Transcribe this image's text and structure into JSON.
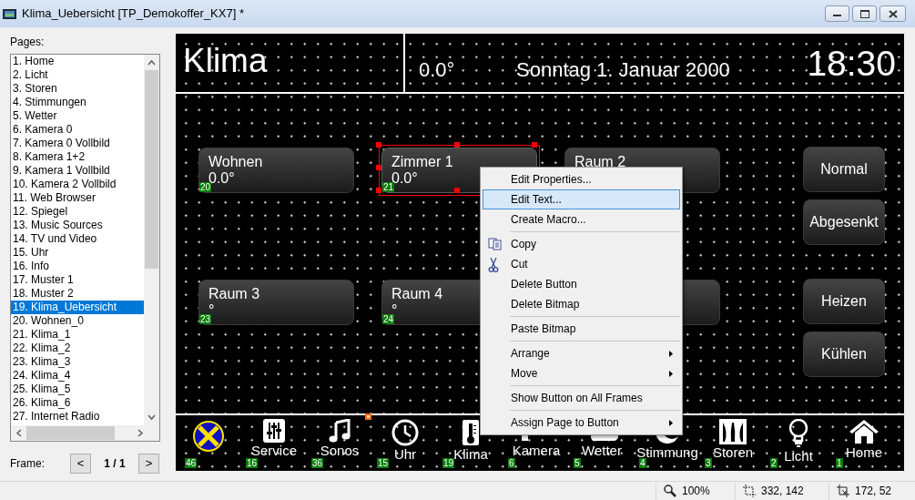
{
  "window": {
    "title": "Klima_Uebersicht [TP_Demokoffer_KX7] *"
  },
  "pages": {
    "label": "Pages:",
    "items": [
      {
        "label": "1. Home",
        "selected": false
      },
      {
        "label": "2. Licht",
        "selected": false
      },
      {
        "label": "3. Storen",
        "selected": false
      },
      {
        "label": "4. Stimmungen",
        "selected": false
      },
      {
        "label": "5. Wetter",
        "selected": false
      },
      {
        "label": "6. Kamera 0",
        "selected": false
      },
      {
        "label": "7. Kamera 0 Vollbild",
        "selected": false
      },
      {
        "label": "8. Kamera 1+2",
        "selected": false
      },
      {
        "label": "9. Kamera 1 Vollbild",
        "selected": false
      },
      {
        "label": "10. Kamera 2 Vollbild",
        "selected": false
      },
      {
        "label": "11. Web Browser",
        "selected": false
      },
      {
        "label": "12. Spiegel",
        "selected": false
      },
      {
        "label": "13. Music Sources",
        "selected": false
      },
      {
        "label": "14. TV und Video",
        "selected": false
      },
      {
        "label": "15. Uhr",
        "selected": false
      },
      {
        "label": "16. Info",
        "selected": false
      },
      {
        "label": "17. Muster 1",
        "selected": false
      },
      {
        "label": "18. Muster 2",
        "selected": false
      },
      {
        "label": "19. Klima_Uebersicht",
        "selected": true
      },
      {
        "label": "20. Wohnen_0",
        "selected": false
      },
      {
        "label": "21. Klima_1",
        "selected": false
      },
      {
        "label": "22. Klima_2",
        "selected": false
      },
      {
        "label": "23. Klima_3",
        "selected": false
      },
      {
        "label": "24. Klima_4",
        "selected": false
      },
      {
        "label": "25. Klima_5",
        "selected": false
      },
      {
        "label": "26. Klima_6",
        "selected": false
      },
      {
        "label": "27. Internet Radio",
        "selected": false
      }
    ]
  },
  "frame": {
    "label": "Frame:",
    "prev": "<",
    "value": "1 / 1",
    "next": ">"
  },
  "canvas": {
    "title": "Klima",
    "temperature": "0.0°",
    "date": "Sonntag 1. Januar 2000",
    "time": "18:30",
    "room_buttons": [
      {
        "name": "Wohnen",
        "value": "0.0°",
        "number": "20",
        "selected": false
      },
      {
        "name": "Zimmer 1",
        "value": "0.0°",
        "number": "21",
        "selected": true
      },
      {
        "name": "Raum 2",
        "selected": false
      },
      {
        "name": "Raum 3",
        "value": "°",
        "number": "23",
        "selected": false
      },
      {
        "name": "Raum 4",
        "value": "°",
        "number": "24",
        "selected": false
      },
      {
        "selected": false
      }
    ],
    "mode_buttons": [
      {
        "label": "Normal"
      },
      {
        "label": "Abgesenkt"
      },
      {
        "label": "Heizen"
      },
      {
        "label": "Kühlen"
      }
    ],
    "nav_items": [
      {
        "kind": "logo",
        "number": "46"
      },
      {
        "kind": "sliders",
        "label": "Service",
        "number": "16"
      },
      {
        "kind": "music",
        "label": "Sonos",
        "number": "36",
        "marked": true
      },
      {
        "kind": "clock",
        "label": "Uhr",
        "number": "15"
      },
      {
        "kind": "thermometer",
        "label": "Klima",
        "number": "19"
      },
      {
        "kind": "camera",
        "label": "Kamera",
        "number": "6"
      },
      {
        "kind": "weather",
        "label": "Wetter",
        "number": "5"
      },
      {
        "kind": "moon",
        "label": "Stimmung",
        "number": "4"
      },
      {
        "kind": "window",
        "label": "Storen",
        "number": "3"
      },
      {
        "kind": "bulb",
        "label": "Licht",
        "number": "2"
      },
      {
        "kind": "home",
        "label": "Home",
        "number": "1"
      }
    ]
  },
  "context_menu": {
    "items": [
      {
        "kind": "item",
        "label": "Edit Properties...",
        "selected": false
      },
      {
        "kind": "item",
        "label": "Edit Text...",
        "selected": true
      },
      {
        "kind": "item",
        "label": "Create Macro...",
        "selected": false
      },
      {
        "kind": "separator"
      },
      {
        "kind": "copy",
        "label": "Copy",
        "selected": false
      },
      {
        "kind": "cut",
        "label": "Cut",
        "selected": false
      },
      {
        "kind": "item",
        "label": "Delete Button",
        "selected": false
      },
      {
        "kind": "item",
        "label": "Delete Bitmap",
        "selected": false
      },
      {
        "kind": "separator"
      },
      {
        "kind": "item",
        "label": "Paste Bitmap",
        "selected": false
      },
      {
        "kind": "separator"
      },
      {
        "kind": "item",
        "label": "Arrange",
        "submenu": true,
        "selected": false
      },
      {
        "kind": "item",
        "label": "Move",
        "submenu": true,
        "selected": false
      },
      {
        "kind": "separator"
      },
      {
        "kind": "item",
        "label": "Show Button on All Frames",
        "selected": false
      },
      {
        "kind": "separator"
      },
      {
        "kind": "item",
        "label": "Assign Page to Button",
        "submenu": true,
        "selected": false
      }
    ]
  },
  "status_bar": {
    "zoom": "100%",
    "position": "332, 142",
    "size": "172, 52"
  }
}
